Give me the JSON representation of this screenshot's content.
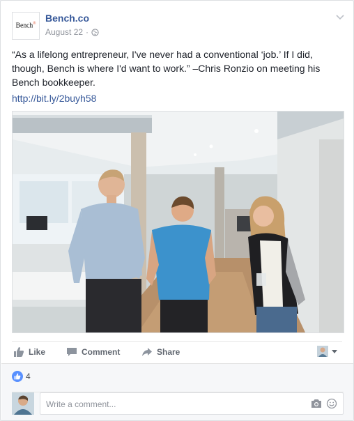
{
  "post": {
    "page_name": "Bench.co",
    "logo_text": "Bench",
    "date": "August 22",
    "separator": "·",
    "privacy_icon": "globe-icon",
    "text": "“As a lifelong entrepreneur, I've never had a conventional ‘job.’ If I did, though, Bench is where I'd want to work.” –Chris Ronzio on meeting his Bench bookkeeper.",
    "link": "http://bit.ly/2buyh58"
  },
  "actions": {
    "like_label": "Like",
    "comment_label": "Comment",
    "share_label": "Share"
  },
  "reactions": {
    "like_count": "4"
  },
  "comment": {
    "placeholder": "Write a comment..."
  },
  "colors": {
    "link_blue": "#365899",
    "like_blue": "#5890ff",
    "muted_text": "#90949c",
    "footer_bg": "#f6f7f9"
  }
}
